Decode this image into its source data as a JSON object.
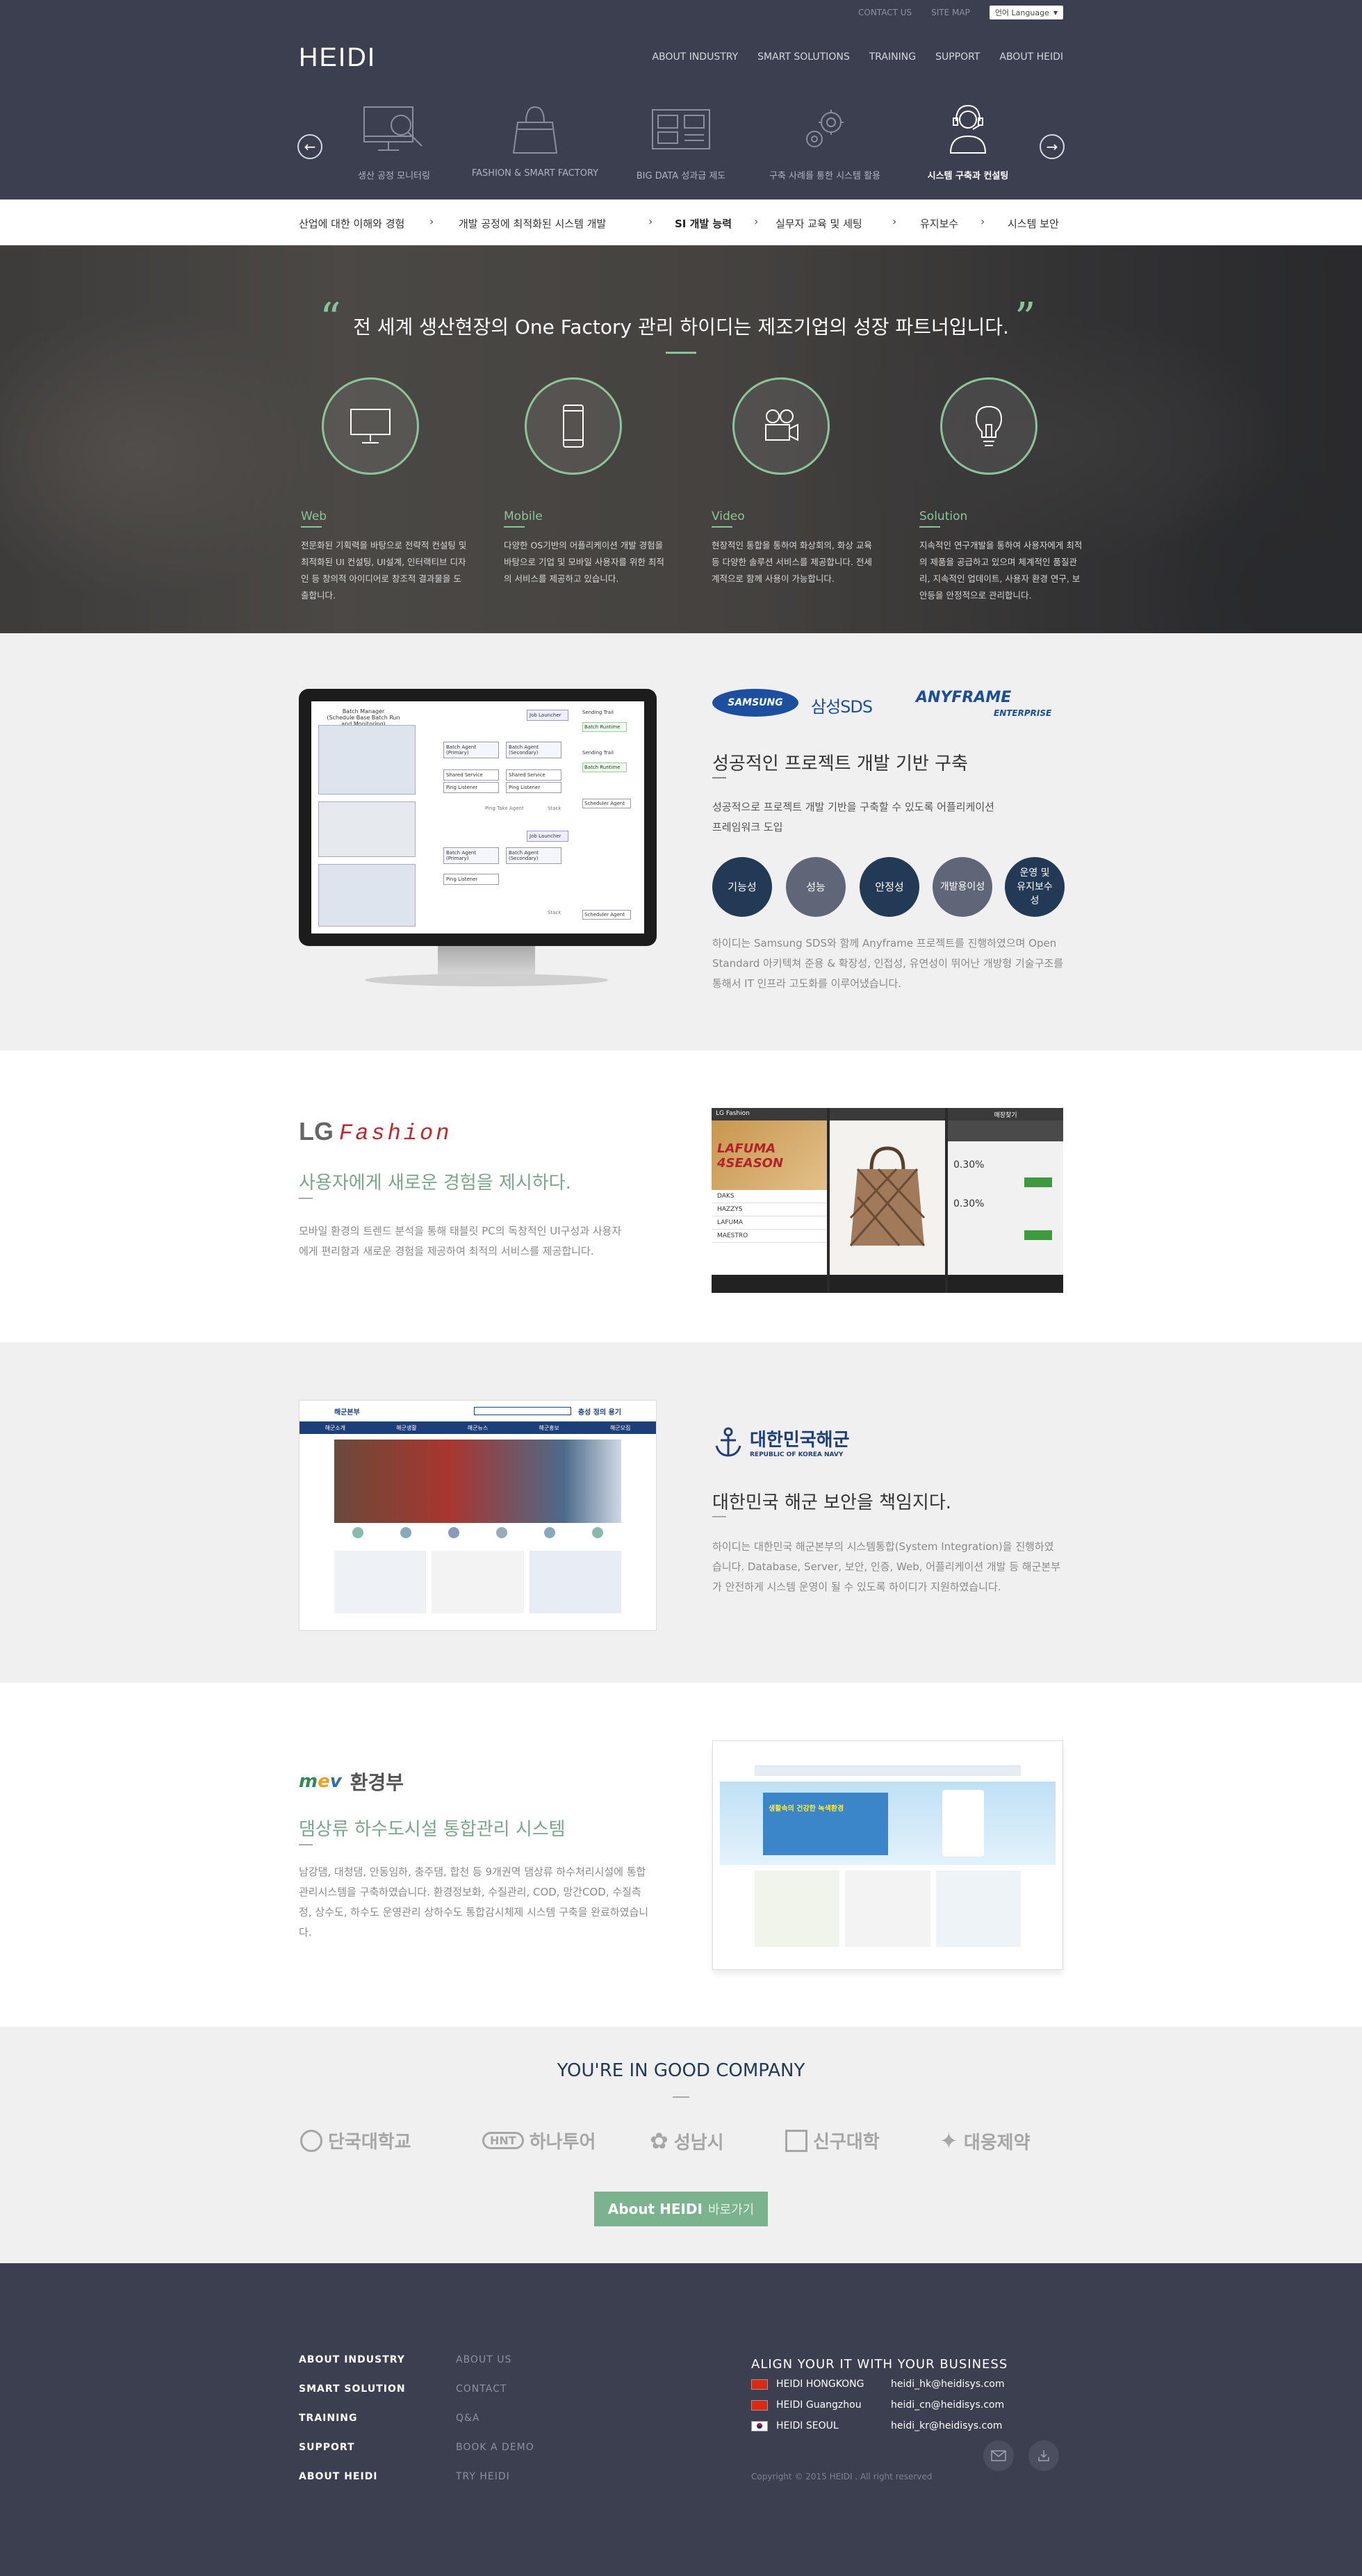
{
  "header": {
    "top_links": [
      "CONTACT US",
      "SITE MAP"
    ],
    "language": "언어 Language",
    "logo": "HEIDI",
    "nav": [
      "ABOUT INDUSTRY",
      "SMART SOLUTIONS",
      "TRAINING",
      "SUPPORT",
      "ABOUT HEIDI"
    ],
    "categories": [
      {
        "label": "생산 공정 모니터링",
        "icon": "monitor-search-icon"
      },
      {
        "label": "FASHION & SMART FACTORY",
        "icon": "shopping-bag-icon"
      },
      {
        "label": "BIG DATA 성과급 제도",
        "icon": "data-grid-icon"
      },
      {
        "label": "구축 사례를 통한 시스템 활용",
        "icon": "gears-icon"
      },
      {
        "label": "시스템 구축과 컨설팅",
        "icon": "headset-icon"
      }
    ]
  },
  "subnav": [
    "산업에 대한 이해와 경험",
    "개발 공정에 최적화된 시스템 개발",
    "SI 개발 능력",
    "실무자 교육 및 세팅",
    "유지보수",
    "시스템 보안"
  ],
  "hero": {
    "title": "전 세계 생산현장의 One Factory 관리 하이디는 제조기업의 성장 파트너입니다.",
    "services": [
      {
        "name": "Web",
        "icon": "desktop-icon",
        "desc": "전문화된 기획력을 바탕으로 전략적 컨설팅 및 최적화된 UI 컨설팅, UI설계, 인터랙티브 디자인 등 창의적 아이디어로 창조적 결과물을 도출합니다."
      },
      {
        "name": "Mobile",
        "icon": "mobile-icon",
        "desc": "다양한 OS기반의 어플리케이션 개발 경험을 바탕으로 기업 및 모바일 사용자를 위한 최적의 서비스를 제공하고 있습니다."
      },
      {
        "name": "Video",
        "icon": "video-camera-icon",
        "desc": "현장적인 통합을 통하여 화상회의, 화상 교육 등 다양한 솔루션 서비스를 제공합니다. 전세계적으로 함께 사용이 가능합니다."
      },
      {
        "name": "Solution",
        "icon": "lightbulb-icon",
        "desc": "지속적인 연구개발을 통하여 사용자에게 최적의 제품을 공급하고 있으며 체계적인 품질관리, 지속적인 업데이트, 사용자 환경 연구, 보안등을 안정적으로 관리합니다."
      }
    ]
  },
  "samsung": {
    "logos": [
      "SAMSUNG",
      "삼성SDS",
      "ANYFRAME",
      "ENTERPRISE"
    ],
    "title": "성공적인 프로젝트 개발 기반 구축",
    "subtitle": "성공적으로 프로젝트 개발 기반을 구축할 수 있도록 어플리케이션 프레임워크 도입",
    "badges": [
      {
        "label": "기능성",
        "color": "#223a55"
      },
      {
        "label": "성능",
        "color": "#5f6677"
      },
      {
        "label": "안정성",
        "color": "#223a55"
      },
      {
        "label": "개발용이성",
        "color": "#5f6677"
      },
      {
        "label": "운영 및 유지보수성",
        "color": "#223a55"
      }
    ],
    "desc": "하이디는 Samsung SDS와 함께 Anyframe 프로젝트를 진행하였으며 Open Standard 아키텍쳐 준용 & 확장성, 인접성, 유연성이 뛰어난 개방형 기술구조를 통해서 IT 인프라 고도화를 이루어냈습니다.",
    "screen": {
      "header": "Batch Manager",
      "subheader": "(Schedule Base Batch Run and Monitoring)",
      "agents": [
        "Batch Agent (Primary)",
        "Batch Agent (Secondary)",
        "Job Launcher",
        "Job Launcher",
        "Job Launcher"
      ],
      "services": [
        "Shared Service",
        "Shared Service",
        "Ping Listener",
        "Ping Listener",
        "Ping Listener"
      ],
      "flows": [
        "Sending Trail",
        "Batch Runtime",
        "Sending Trail",
        "Batch Runtime",
        "Scheduler Agent",
        "Scheduler Agent"
      ],
      "labels": [
        "Ping Take Agent",
        "Stack",
        "Stack"
      ]
    }
  },
  "lg": {
    "logo_lg": "LG",
    "logo_fashion": "Fashion",
    "title": "사용자에게 새로운 경험을 제시하다.",
    "desc": "모바일 환경의 트렌드 분석을 통해 태블릿 PC의 독창적인 UI구성과 사용자에게 편리함과 새로운 경험을 제공하여 최적의 서비스를 제공합니다.",
    "app": {
      "title": "LG Fashion",
      "banner": "LAFUMA 4SEASON",
      "brands": [
        "DAKS",
        "HAZZYS",
        "LAFUMA",
        "MAESTRO"
      ],
      "prices": [
        "0.30%",
        "0.30%"
      ],
      "header3": "매장찾기"
    }
  },
  "navy": {
    "logo": "대한민국해군",
    "logo_sub": "REPUBLIC OF KOREA NAVY",
    "title": "대한민국 해군 보안을 책임지다.",
    "desc": "하이디는 대한민국 해군본부의 시스템통합(System Integration)을 진행하였습니다. Database, Server, 보안, 인증, Web, 어플리케이션 개발 등 해군본부가 안전하게 시스템 운영이 될 수 있도록 하이디가 지원하였습니다.",
    "site": {
      "logo": "해군본부",
      "menu": [
        "해군소개",
        "해군생활",
        "해군뉴스",
        "해군홍보",
        "해군모집"
      ],
      "quick_menu": "충성 정의 용기"
    }
  },
  "me": {
    "logo": "환경부",
    "title": "댐상류 하수도시설 통합관리 시스템",
    "desc": "남강댐, 대청댐, 안동임하, 충주댐, 합천 등 9개권역 댐상류 하수처리시설에 통합관리시스템을 구축하였습니다. 환경정보화, 수질관리, COD, 망간COD, 수질측정, 상수도, 하수도 운영관리 상하수도 통합감시체제 시스템 구축을 완료하였습니다.",
    "site": {
      "banner": "생활속의 건강한 녹색환경"
    }
  },
  "company": {
    "title": "YOU'RE IN GOOD COMPANY",
    "logos": [
      "단국대학교",
      "하나투어",
      "성남시",
      "신구대학",
      "대웅제약"
    ],
    "about_btn": "About HEIDI",
    "about_btn_sub": "바로가기"
  },
  "footer": {
    "col1": [
      "ABOUT INDUSTRY",
      "SMART SOLUTION",
      "TRAINING",
      "SUPPORT",
      "ABOUT HEIDI"
    ],
    "col2": [
      "ABOUT US",
      "CONTACT",
      "Q&A",
      "BOOK A DEMO",
      "TRY HEIDI"
    ],
    "offices_title": "ALIGN YOUR IT WITH YOUR BUSINESS",
    "offices": [
      {
        "name": "HEIDI  HONGKONG",
        "email": "heidi_hk@heidisys.com",
        "flag": "hong-kong-flag-icon"
      },
      {
        "name": "HEIDI  Guangzhou",
        "email": "heidi_cn@heidisys.com",
        "flag": "china-flag-icon"
      },
      {
        "name": "HEIDI  SEOUL",
        "email": "heidi_kr@heidisys.com",
        "flag": "korea-flag-icon"
      }
    ],
    "copyright": "Copyright © 2015 HEIDI . All right reserved"
  }
}
